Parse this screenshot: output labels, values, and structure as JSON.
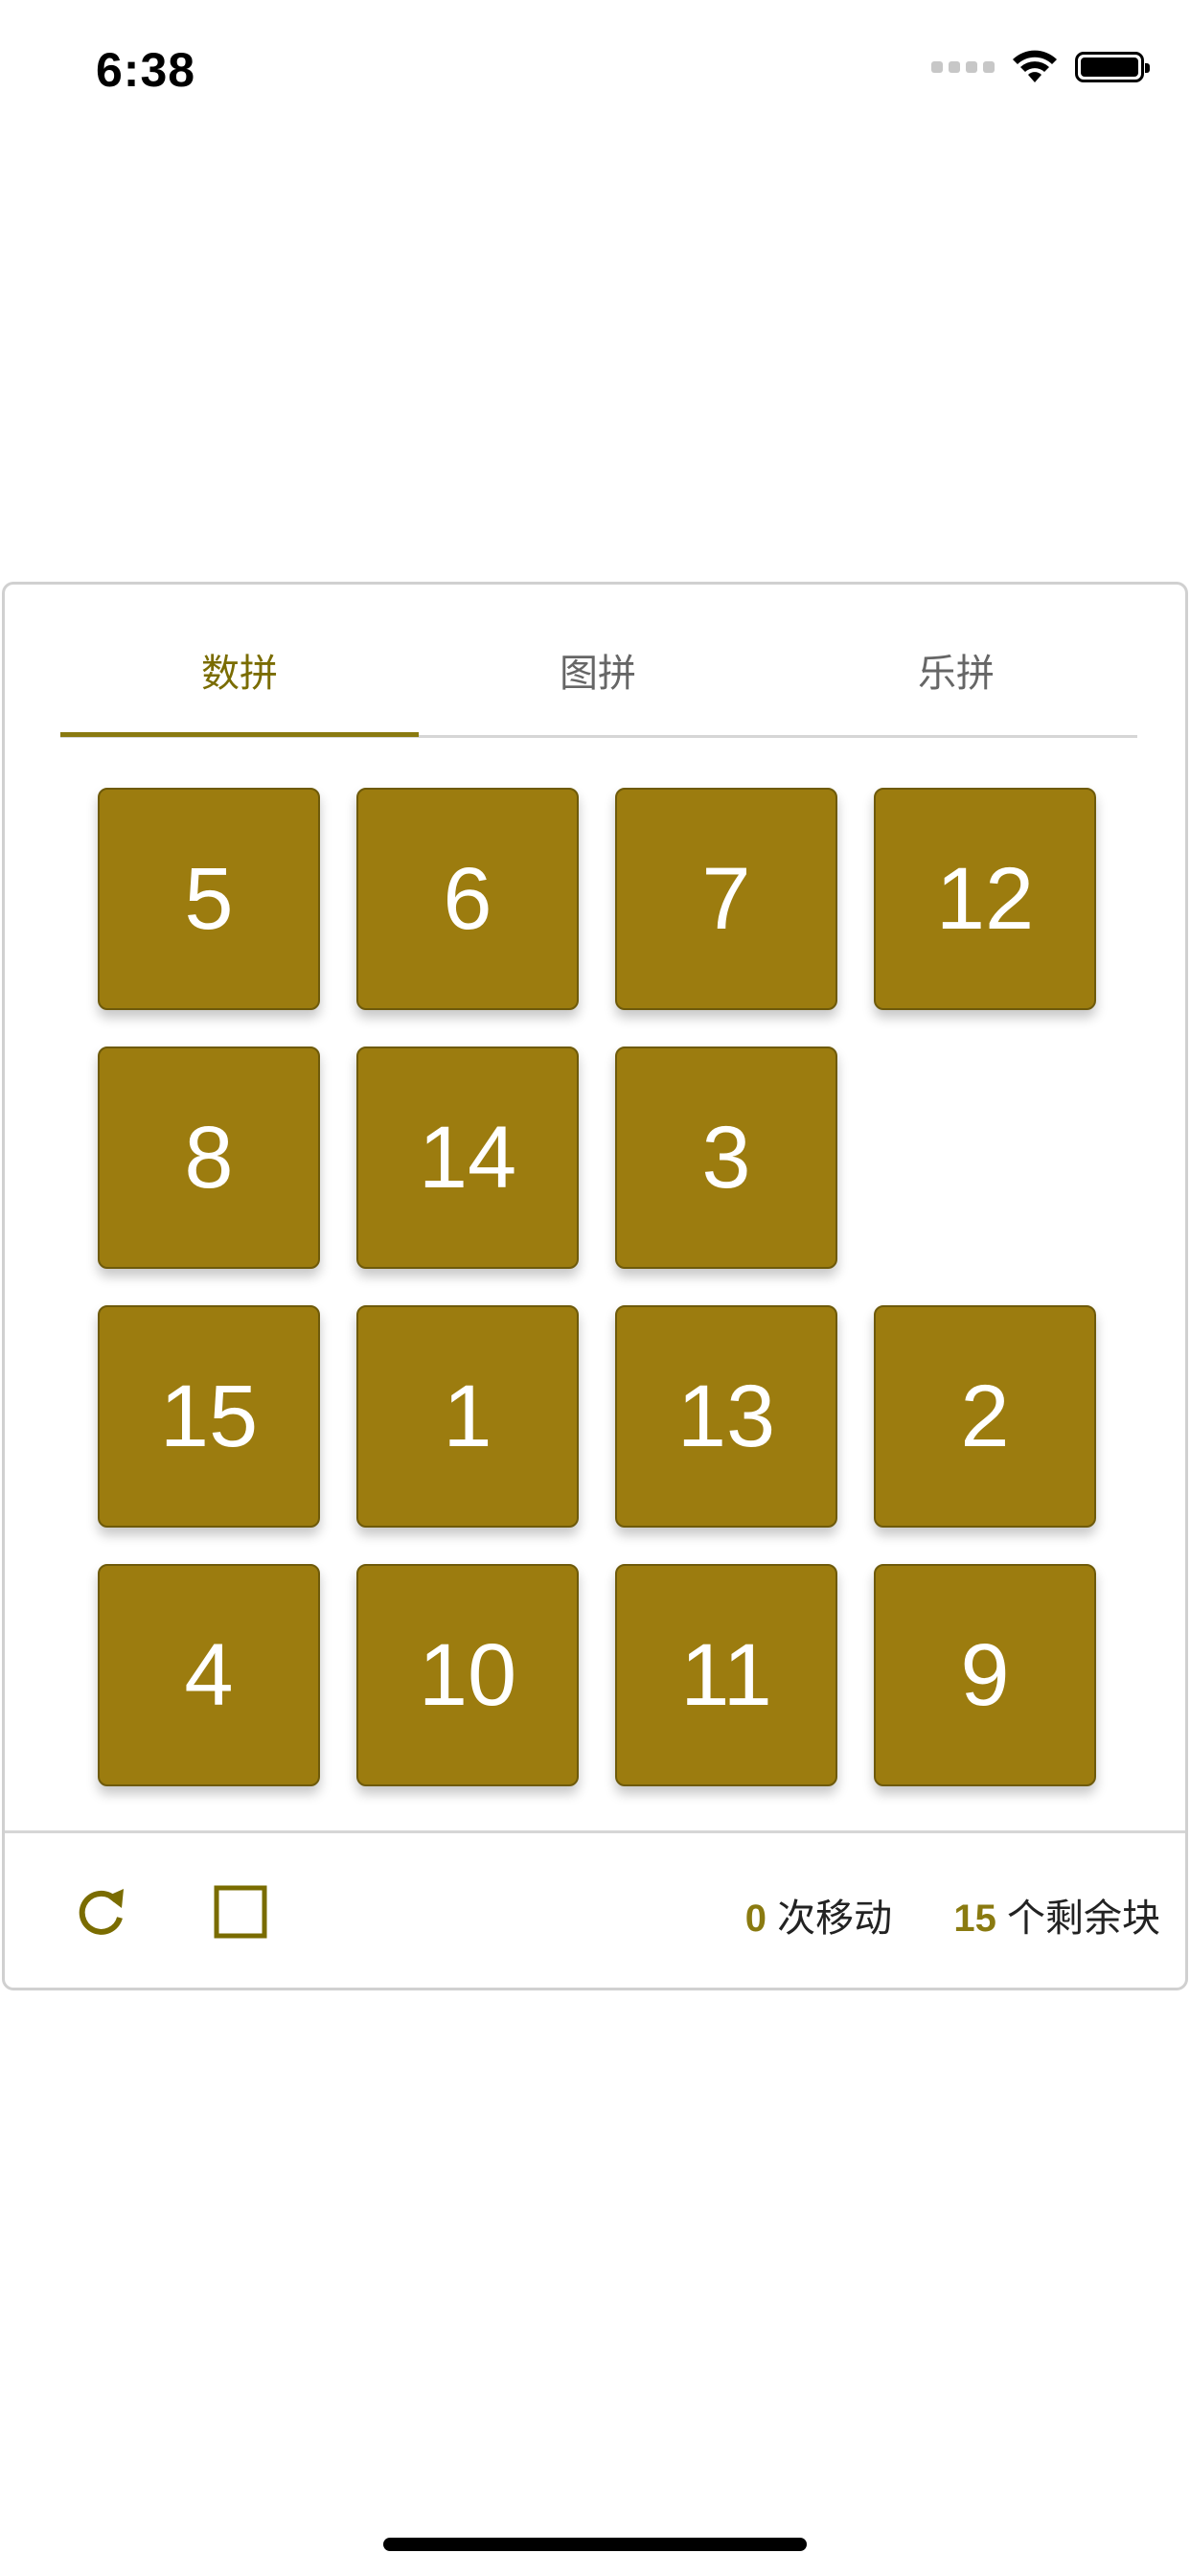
{
  "status_bar": {
    "time": "6:38"
  },
  "tabs": [
    {
      "label": "数拼",
      "active": true
    },
    {
      "label": "图拼",
      "active": false
    },
    {
      "label": "乐拼",
      "active": false
    }
  ],
  "board": {
    "tiles": [
      "5",
      "6",
      "7",
      "12",
      "8",
      "14",
      "3",
      "",
      "15",
      "1",
      "13",
      "2",
      "4",
      "10",
      "11",
      "9"
    ],
    "tile_color": "#9c7c0f",
    "accent_color": "#8a7a10"
  },
  "footer": {
    "refresh_icon": "refresh-icon",
    "square_icon": "square-icon",
    "moves_count": "0",
    "moves_label": "次移动",
    "remaining_count": "15",
    "remaining_label": "个剩余块"
  }
}
